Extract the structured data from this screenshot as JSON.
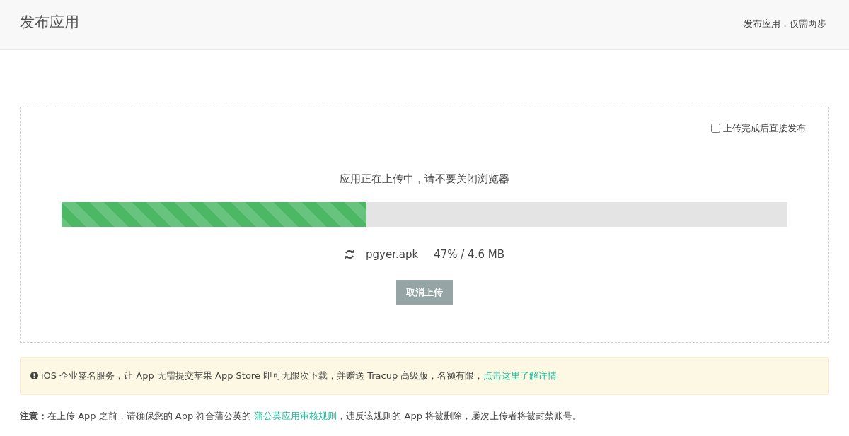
{
  "header": {
    "title": "发布应用",
    "subtitle": "发布应用，仅需两步"
  },
  "upload": {
    "auto_publish": {
      "label": "上传完成后直接发布",
      "checked": false
    },
    "message": "应用正在上传中，请不要关闭浏览器",
    "progress": {
      "level": 0.42
    },
    "file_name": "pgyer.apk",
    "status": "47% / 4.6 MB",
    "cancel_button": "取消上传"
  },
  "alert": {
    "text": "iOS 企业签名服务，让 App 无需提交苹果 App Store 即可无限次下载，并赠送 Tracup 高级版，名额有限，",
    "link": "点击这里了解详情"
  },
  "notice": {
    "text": "**注意：**在上传 App 之前，请确保您的 App 符合蒲公英的 ",
    "link": "蒲公英应用审核规则",
    "text_after": "，违反该规则的 App 将被删除，屡次上传者将被封禁账号。"
  }
}
